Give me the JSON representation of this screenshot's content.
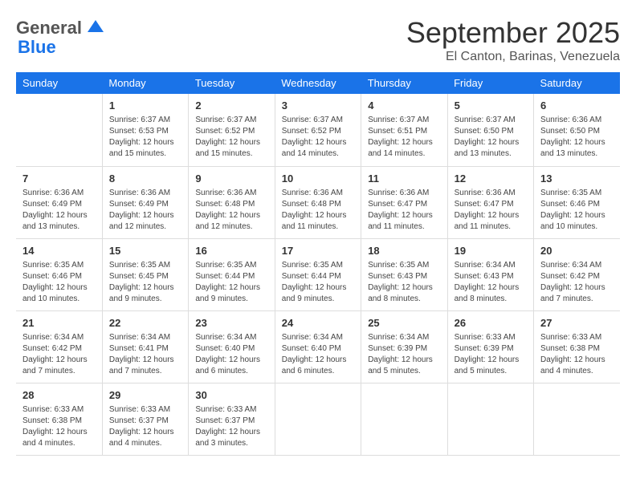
{
  "logo": {
    "general": "General",
    "blue": "Blue"
  },
  "title": "September 2025",
  "subtitle": "El Canton, Barinas, Venezuela",
  "weekdays": [
    "Sunday",
    "Monday",
    "Tuesday",
    "Wednesday",
    "Thursday",
    "Friday",
    "Saturday"
  ],
  "weeks": [
    [
      {
        "day": "",
        "info": ""
      },
      {
        "day": "1",
        "info": "Sunrise: 6:37 AM\nSunset: 6:53 PM\nDaylight: 12 hours\nand 15 minutes."
      },
      {
        "day": "2",
        "info": "Sunrise: 6:37 AM\nSunset: 6:52 PM\nDaylight: 12 hours\nand 15 minutes."
      },
      {
        "day": "3",
        "info": "Sunrise: 6:37 AM\nSunset: 6:52 PM\nDaylight: 12 hours\nand 14 minutes."
      },
      {
        "day": "4",
        "info": "Sunrise: 6:37 AM\nSunset: 6:51 PM\nDaylight: 12 hours\nand 14 minutes."
      },
      {
        "day": "5",
        "info": "Sunrise: 6:37 AM\nSunset: 6:50 PM\nDaylight: 12 hours\nand 13 minutes."
      },
      {
        "day": "6",
        "info": "Sunrise: 6:36 AM\nSunset: 6:50 PM\nDaylight: 12 hours\nand 13 minutes."
      }
    ],
    [
      {
        "day": "7",
        "info": "Sunrise: 6:36 AM\nSunset: 6:49 PM\nDaylight: 12 hours\nand 13 minutes."
      },
      {
        "day": "8",
        "info": "Sunrise: 6:36 AM\nSunset: 6:49 PM\nDaylight: 12 hours\nand 12 minutes."
      },
      {
        "day": "9",
        "info": "Sunrise: 6:36 AM\nSunset: 6:48 PM\nDaylight: 12 hours\nand 12 minutes."
      },
      {
        "day": "10",
        "info": "Sunrise: 6:36 AM\nSunset: 6:48 PM\nDaylight: 12 hours\nand 11 minutes."
      },
      {
        "day": "11",
        "info": "Sunrise: 6:36 AM\nSunset: 6:47 PM\nDaylight: 12 hours\nand 11 minutes."
      },
      {
        "day": "12",
        "info": "Sunrise: 6:36 AM\nSunset: 6:47 PM\nDaylight: 12 hours\nand 11 minutes."
      },
      {
        "day": "13",
        "info": "Sunrise: 6:35 AM\nSunset: 6:46 PM\nDaylight: 12 hours\nand 10 minutes."
      }
    ],
    [
      {
        "day": "14",
        "info": "Sunrise: 6:35 AM\nSunset: 6:46 PM\nDaylight: 12 hours\nand 10 minutes."
      },
      {
        "day": "15",
        "info": "Sunrise: 6:35 AM\nSunset: 6:45 PM\nDaylight: 12 hours\nand 9 minutes."
      },
      {
        "day": "16",
        "info": "Sunrise: 6:35 AM\nSunset: 6:44 PM\nDaylight: 12 hours\nand 9 minutes."
      },
      {
        "day": "17",
        "info": "Sunrise: 6:35 AM\nSunset: 6:44 PM\nDaylight: 12 hours\nand 9 minutes."
      },
      {
        "day": "18",
        "info": "Sunrise: 6:35 AM\nSunset: 6:43 PM\nDaylight: 12 hours\nand 8 minutes."
      },
      {
        "day": "19",
        "info": "Sunrise: 6:34 AM\nSunset: 6:43 PM\nDaylight: 12 hours\nand 8 minutes."
      },
      {
        "day": "20",
        "info": "Sunrise: 6:34 AM\nSunset: 6:42 PM\nDaylight: 12 hours\nand 7 minutes."
      }
    ],
    [
      {
        "day": "21",
        "info": "Sunrise: 6:34 AM\nSunset: 6:42 PM\nDaylight: 12 hours\nand 7 minutes."
      },
      {
        "day": "22",
        "info": "Sunrise: 6:34 AM\nSunset: 6:41 PM\nDaylight: 12 hours\nand 7 minutes."
      },
      {
        "day": "23",
        "info": "Sunrise: 6:34 AM\nSunset: 6:40 PM\nDaylight: 12 hours\nand 6 minutes."
      },
      {
        "day": "24",
        "info": "Sunrise: 6:34 AM\nSunset: 6:40 PM\nDaylight: 12 hours\nand 6 minutes."
      },
      {
        "day": "25",
        "info": "Sunrise: 6:34 AM\nSunset: 6:39 PM\nDaylight: 12 hours\nand 5 minutes."
      },
      {
        "day": "26",
        "info": "Sunrise: 6:33 AM\nSunset: 6:39 PM\nDaylight: 12 hours\nand 5 minutes."
      },
      {
        "day": "27",
        "info": "Sunrise: 6:33 AM\nSunset: 6:38 PM\nDaylight: 12 hours\nand 4 minutes."
      }
    ],
    [
      {
        "day": "28",
        "info": "Sunrise: 6:33 AM\nSunset: 6:38 PM\nDaylight: 12 hours\nand 4 minutes."
      },
      {
        "day": "29",
        "info": "Sunrise: 6:33 AM\nSunset: 6:37 PM\nDaylight: 12 hours\nand 4 minutes."
      },
      {
        "day": "30",
        "info": "Sunrise: 6:33 AM\nSunset: 6:37 PM\nDaylight: 12 hours\nand 3 minutes."
      },
      {
        "day": "",
        "info": ""
      },
      {
        "day": "",
        "info": ""
      },
      {
        "day": "",
        "info": ""
      },
      {
        "day": "",
        "info": ""
      }
    ]
  ]
}
